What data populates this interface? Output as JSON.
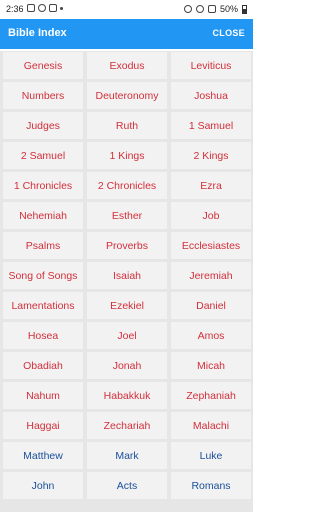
{
  "status_bar": {
    "time": "2:36",
    "battery": "50%"
  },
  "app_bar": {
    "title": "Bible Index",
    "close_label": "CLOSE"
  },
  "books": [
    {
      "name": "Genesis",
      "testament": "old"
    },
    {
      "name": "Exodus",
      "testament": "old"
    },
    {
      "name": "Leviticus",
      "testament": "old"
    },
    {
      "name": "Numbers",
      "testament": "old"
    },
    {
      "name": "Deuteronomy",
      "testament": "old"
    },
    {
      "name": "Joshua",
      "testament": "old"
    },
    {
      "name": "Judges",
      "testament": "old"
    },
    {
      "name": "Ruth",
      "testament": "old"
    },
    {
      "name": "1 Samuel",
      "testament": "old"
    },
    {
      "name": "2 Samuel",
      "testament": "old"
    },
    {
      "name": "1 Kings",
      "testament": "old"
    },
    {
      "name": "2 Kings",
      "testament": "old"
    },
    {
      "name": "1 Chronicles",
      "testament": "old"
    },
    {
      "name": "2 Chronicles",
      "testament": "old"
    },
    {
      "name": "Ezra",
      "testament": "old"
    },
    {
      "name": "Nehemiah",
      "testament": "old"
    },
    {
      "name": "Esther",
      "testament": "old"
    },
    {
      "name": "Job",
      "testament": "old"
    },
    {
      "name": "Psalms",
      "testament": "old"
    },
    {
      "name": "Proverbs",
      "testament": "old"
    },
    {
      "name": "Ecclesiastes",
      "testament": "old"
    },
    {
      "name": "Song of Songs",
      "testament": "old"
    },
    {
      "name": "Isaiah",
      "testament": "old"
    },
    {
      "name": "Jeremiah",
      "testament": "old"
    },
    {
      "name": "Lamentations",
      "testament": "old"
    },
    {
      "name": "Ezekiel",
      "testament": "old"
    },
    {
      "name": "Daniel",
      "testament": "old"
    },
    {
      "name": "Hosea",
      "testament": "old"
    },
    {
      "name": "Joel",
      "testament": "old"
    },
    {
      "name": "Amos",
      "testament": "old"
    },
    {
      "name": "Obadiah",
      "testament": "old"
    },
    {
      "name": "Jonah",
      "testament": "old"
    },
    {
      "name": "Micah",
      "testament": "old"
    },
    {
      "name": "Nahum",
      "testament": "old"
    },
    {
      "name": "Habakkuk",
      "testament": "old"
    },
    {
      "name": "Zephaniah",
      "testament": "old"
    },
    {
      "name": "Haggai",
      "testament": "old"
    },
    {
      "name": "Zechariah",
      "testament": "old"
    },
    {
      "name": "Malachi",
      "testament": "old"
    },
    {
      "name": "Matthew",
      "testament": "new"
    },
    {
      "name": "Mark",
      "testament": "new"
    },
    {
      "name": "Luke",
      "testament": "new"
    },
    {
      "name": "John",
      "testament": "new"
    },
    {
      "name": "Acts",
      "testament": "new"
    },
    {
      "name": "Romans",
      "testament": "new"
    }
  ],
  "colors": {
    "app_bar": "#2196f3",
    "old_testament": "#d32f3b",
    "new_testament": "#1a4f9a"
  }
}
